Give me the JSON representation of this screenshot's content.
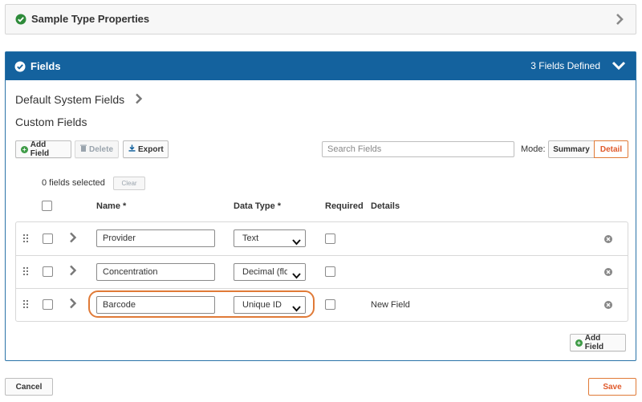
{
  "panel_properties": {
    "title": "Sample Type Properties",
    "status": "valid"
  },
  "panel_fields": {
    "title": "Fields",
    "count_text": "3 Fields Defined",
    "default_system_fields": "Default System Fields",
    "custom_fields": "Custom Fields",
    "toolbar": {
      "add_field": "Add Field",
      "delete": "Delete",
      "export": "Export"
    },
    "search": {
      "placeholder": "Search Fields",
      "value": ""
    },
    "mode": {
      "label": "Mode:",
      "summary": "Summary",
      "detail": "Detail",
      "selected": "Detail"
    },
    "selection": {
      "count_text": "0 fields selected",
      "clear": "Clear"
    },
    "columns": {
      "name": "Name *",
      "data_type": "Data Type *",
      "required": "Required",
      "details": "Details"
    },
    "rows": [
      {
        "name": "Provider",
        "data_type": "Text",
        "required": false,
        "details": ""
      },
      {
        "name": "Concentration",
        "data_type": "Decimal (floating point)",
        "required": false,
        "details": ""
      },
      {
        "name": "Barcode",
        "data_type": "Unique ID",
        "required": false,
        "details": "New Field"
      }
    ],
    "add_field_bottom": "Add Field"
  },
  "footer": {
    "cancel": "Cancel",
    "save": "Save"
  },
  "colors": {
    "header_blue": "#14629e",
    "accent_orange": "#e07a37",
    "valid_green": "#2e8b3a"
  }
}
